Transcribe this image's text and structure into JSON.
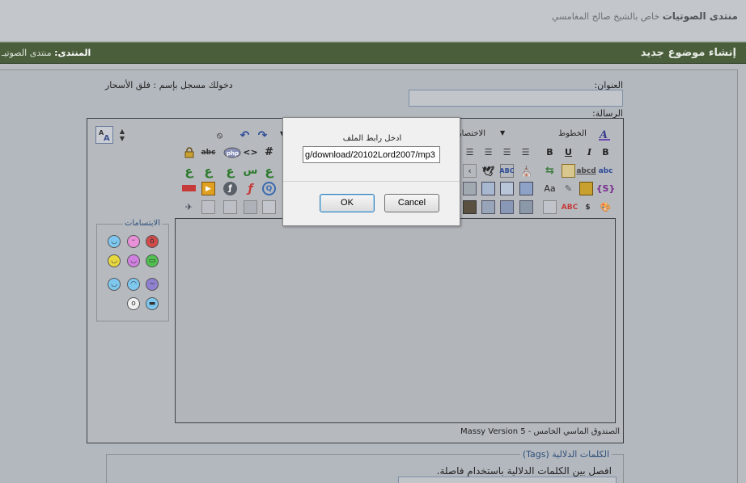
{
  "header": {
    "forum_name": "منتدى الصوتيات",
    "forum_sub": "خاص بالشيخ صالح المغامسي"
  },
  "nav": {
    "new_topic": "إنشاء موضوع جديد",
    "breadcrumb_label": "المنتدى:",
    "breadcrumb_value": "منتدى الصوتيـ"
  },
  "form": {
    "title_label": "العنوان:",
    "message_label": "الرسالة:",
    "logged_in": "دخولك مسجل بإسم : فلق الأسحار"
  },
  "toolbar": {
    "fonts_label": "الخطوط",
    "shortcuts_label": "الاختصارا",
    "icons": [
      "spellcheck-icon",
      "bold-icon",
      "underline-icon",
      "italic-icon",
      "bold-alt-icon",
      "align-justify-icon",
      "align-center-icon",
      "align-right-icon",
      "align-left-icon",
      "undo-icon",
      "redo-icon",
      "hash-icon",
      "code-icon",
      "php-icon",
      "abc-strike-icon",
      "lock-icon"
    ]
  },
  "smilies": {
    "legend": "الابتسامات",
    "items": [
      "angry",
      "tongue",
      "happy",
      "grin",
      "big-smile",
      "wink",
      "confused",
      "sad",
      "sleepy",
      "cool",
      "shocked",
      "cool-glasses"
    ]
  },
  "editor": {
    "footer": "الصندوق الماسي الخامس - Massy Version 5"
  },
  "tags": {
    "legend": "الكلمات الدلالية (Tags)",
    "hint": "افصل بين الكلمات الدلالية باستخدام فاصلة."
  },
  "dialog": {
    "prompt": "ادخل رابط الملف",
    "input_value": "g/download/20102Lord2007/mp3",
    "ok_label": "OK",
    "cancel_label": "Cancel"
  },
  "colors": {
    "green_bar": "#4a5e3c",
    "page_bg": "#b9bdc2",
    "link_blue": "#2f4f7a"
  }
}
